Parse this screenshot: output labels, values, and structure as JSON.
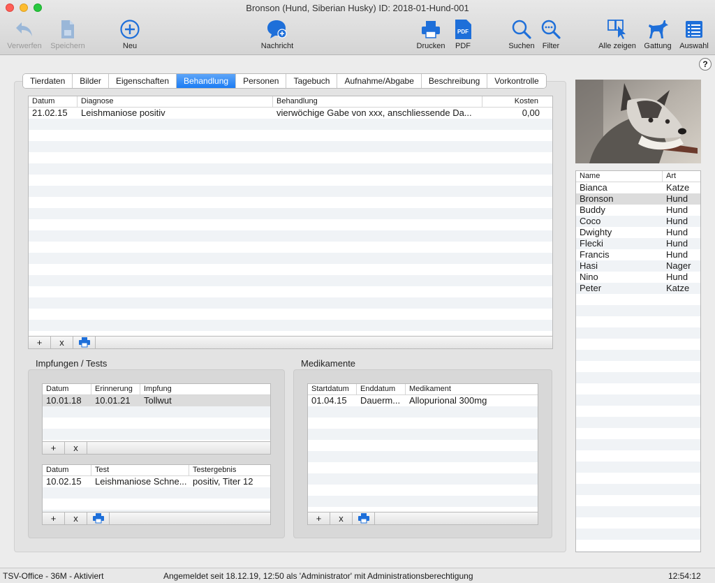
{
  "window": {
    "title": "Bronson (Hund, Siberian Husky) ID: 2018-01-Hund-001"
  },
  "toolbar": {
    "verwerfen": "Verwerfen",
    "speichern": "Speichern",
    "neu": "Neu",
    "nachricht": "Nachricht",
    "drucken": "Drucken",
    "pdf": "PDF",
    "suchen": "Suchen",
    "filter": "Filter",
    "alle_zeigen": "Alle zeigen",
    "gattung": "Gattung",
    "auswahl": "Auswahl"
  },
  "colors": {
    "accent": "#1b7cf4",
    "icon_blue": "#1e6fd9"
  },
  "tabs": [
    "Tierdaten",
    "Bilder",
    "Eigenschaften",
    "Behandlung",
    "Personen",
    "Tagebuch",
    "Aufnahme/Abgabe",
    "Beschreibung",
    "Vorkontrolle"
  ],
  "active_tab": "Behandlung",
  "help": "?",
  "behandlung": {
    "headers": [
      "Datum",
      "Diagnose",
      "Behandlung",
      "Kosten"
    ],
    "rows": [
      {
        "datum": "21.02.15",
        "diagnose": "Leishmaniose positiv",
        "behandlung": "vierwöchige Gabe von xxx, anschliessende Da...",
        "kosten": "0,00"
      }
    ]
  },
  "buttons": {
    "add": "+",
    "remove": "x"
  },
  "impfungen": {
    "title": "Impfungen / Tests",
    "impf_headers": [
      "Datum",
      "Erinnerung",
      "Impfung"
    ],
    "impf_rows": [
      {
        "datum": "10.01.18",
        "erinnerung": "10.01.21",
        "impfung": "Tollwut"
      }
    ],
    "test_headers": [
      "Datum",
      "Test",
      "Testergebnis"
    ],
    "test_rows": [
      {
        "datum": "10.02.15",
        "test": "Leishmaniose Schne...",
        "ergebnis": "positiv, Titer 12"
      }
    ]
  },
  "medikamente": {
    "title": "Medikamente",
    "headers": [
      "Startdatum",
      "Enddatum",
      "Medikament"
    ],
    "rows": [
      {
        "start": "01.04.15",
        "ende": "Dauerm...",
        "medikament": "Allopurional 300mg"
      }
    ]
  },
  "animals": {
    "headers": [
      "Name",
      "Art"
    ],
    "rows": [
      {
        "name": "Bianca",
        "art": "Katze"
      },
      {
        "name": "Bronson",
        "art": "Hund",
        "selected": true
      },
      {
        "name": "Buddy",
        "art": "Hund"
      },
      {
        "name": "Coco",
        "art": "Hund"
      },
      {
        "name": "Dwighty",
        "art": "Hund"
      },
      {
        "name": "Flecki",
        "art": "Hund"
      },
      {
        "name": "Francis",
        "art": "Hund"
      },
      {
        "name": "Hasi",
        "art": "Nager"
      },
      {
        "name": "Nino",
        "art": "Hund"
      },
      {
        "name": "Peter",
        "art": "Katze"
      }
    ]
  },
  "status": {
    "left": "TSV-Office - 36M - Aktiviert",
    "center": "Angemeldet seit 18.12.19, 12:50 als 'Administrator' mit Administrationsberechtigung",
    "time": "12:54:12"
  }
}
